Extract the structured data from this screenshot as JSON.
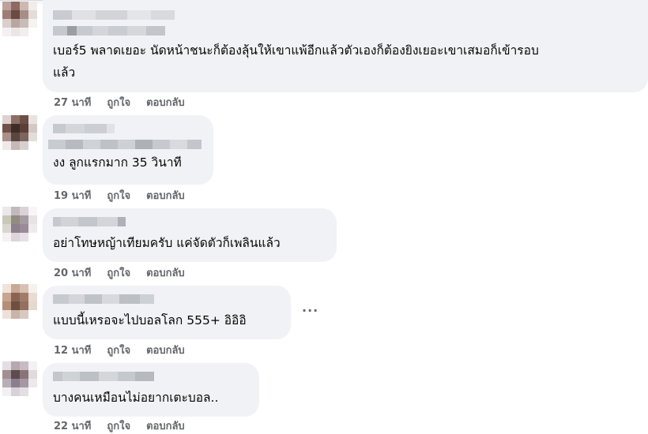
{
  "comments": [
    {
      "text": "เบอร์5 พลาดเยอะ นัดหน้าชนะก็ต้องลุ้นให้เขาแพ้อีกแล้วตัวเองก็ต้องยิงเยอะเขาเสมอก็เข้ารอบ\nแล้ว",
      "time": "27 นาที",
      "like": "ถูกใจ",
      "reply": "ตอบกลับ"
    },
    {
      "text": "งง ลูกแรกมาก 35 วินาที",
      "time": "19 นาที",
      "like": "ถูกใจ",
      "reply": "ตอบกลับ"
    },
    {
      "text": "อย่าโทษหญ้าเทียมครับ แค่จัดตัวก็เพลินแล้ว",
      "time": "20 นาที",
      "like": "ถูกใจ",
      "reply": "ตอบกลับ"
    },
    {
      "text": "แบบนี้เหรอจะไปบอลโลก 555+ อิอิอิ",
      "time": "12 นาที",
      "like": "ถูกใจ",
      "reply": "ตอบกลับ",
      "more": "···"
    },
    {
      "text": "บางคนเหมือนไม่อยากเตะบอล..",
      "time": "22 นาที",
      "like": "ถูกใจ",
      "reply": "ตอบกลับ"
    }
  ]
}
